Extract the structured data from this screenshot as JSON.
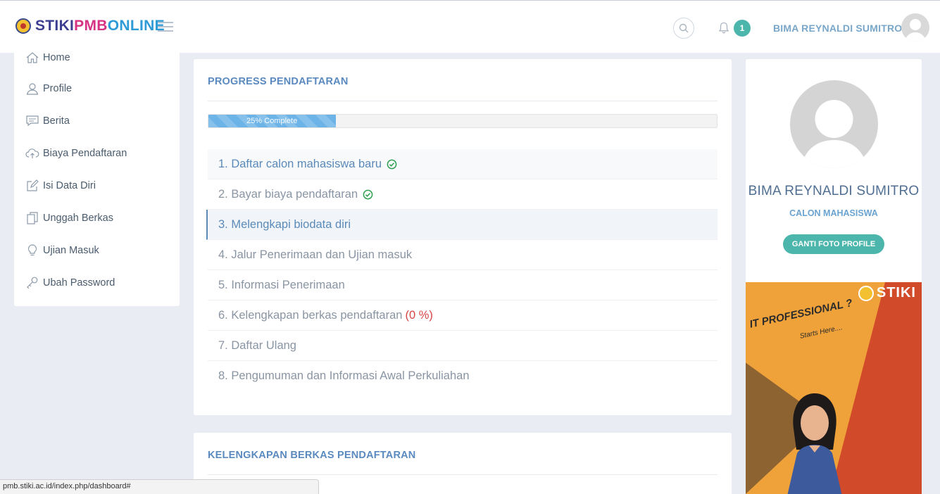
{
  "header": {
    "logo_stiki": "STIKI",
    "logo_pmb": "PMB",
    "logo_online": "ONLINE",
    "notification_count": "1",
    "user_name": "BIMA REYNALDI SUMITRO"
  },
  "sidebar": {
    "items": [
      {
        "label": "Home",
        "icon": "home-icon"
      },
      {
        "label": "Profile",
        "icon": "user-icon"
      },
      {
        "label": "Berita",
        "icon": "chat-icon"
      },
      {
        "label": "Biaya Pendaftaran",
        "icon": "cloud-upload-icon"
      },
      {
        "label": "Isi Data Diri",
        "icon": "edit-icon"
      },
      {
        "label": "Unggah Berkas",
        "icon": "files-icon"
      },
      {
        "label": "Ujian Masuk",
        "icon": "bulb-icon"
      },
      {
        "label": "Ubah Password",
        "icon": "key-icon"
      }
    ]
  },
  "progress_card": {
    "title": "PROGRESS PENDAFTARAN",
    "progress_label": "25% Complete",
    "progress_value": 0.25,
    "steps": [
      {
        "label": "1. Daftar calon mahasiswa baru",
        "state": "done"
      },
      {
        "label": "2. Bayar biaya pendaftaran",
        "state": "done"
      },
      {
        "label": "3. Melengkapi biodata diri",
        "state": "active"
      },
      {
        "label": "4. Jalur Penerimaan dan Ujian masuk",
        "state": "pending"
      },
      {
        "label": "5. Informasi Penerimaan",
        "state": "pending"
      },
      {
        "label": "6. Kelengkapan berkas pendaftaran",
        "state": "pending",
        "extra": "(0 %)"
      },
      {
        "label": "7. Daftar Ulang",
        "state": "pending"
      },
      {
        "label": "8. Pengumuman dan Informasi Awal Perkuliahan",
        "state": "pending"
      }
    ]
  },
  "berkas_card": {
    "title": "KELENGKAPAN BERKAS PENDAFTARAN"
  },
  "profile_card": {
    "name": "BIMA REYNALDI SUMITRO",
    "role": "CALON MAHASISWA",
    "button_label": "GANTI FOTO PROFILE"
  },
  "banner": {
    "brand": "STIKI",
    "headline": "IT PROFESSIONAL ?",
    "sub": "Starts Here...."
  },
  "statusbar": {
    "url": "pmb.stiki.ac.id/index.php/dashboard#"
  },
  "colors": {
    "accent": "#5b8ab8",
    "teal": "#4db6ac",
    "progress": "#6cb3e8",
    "danger": "#d64545",
    "success": "#2e9e4f"
  }
}
